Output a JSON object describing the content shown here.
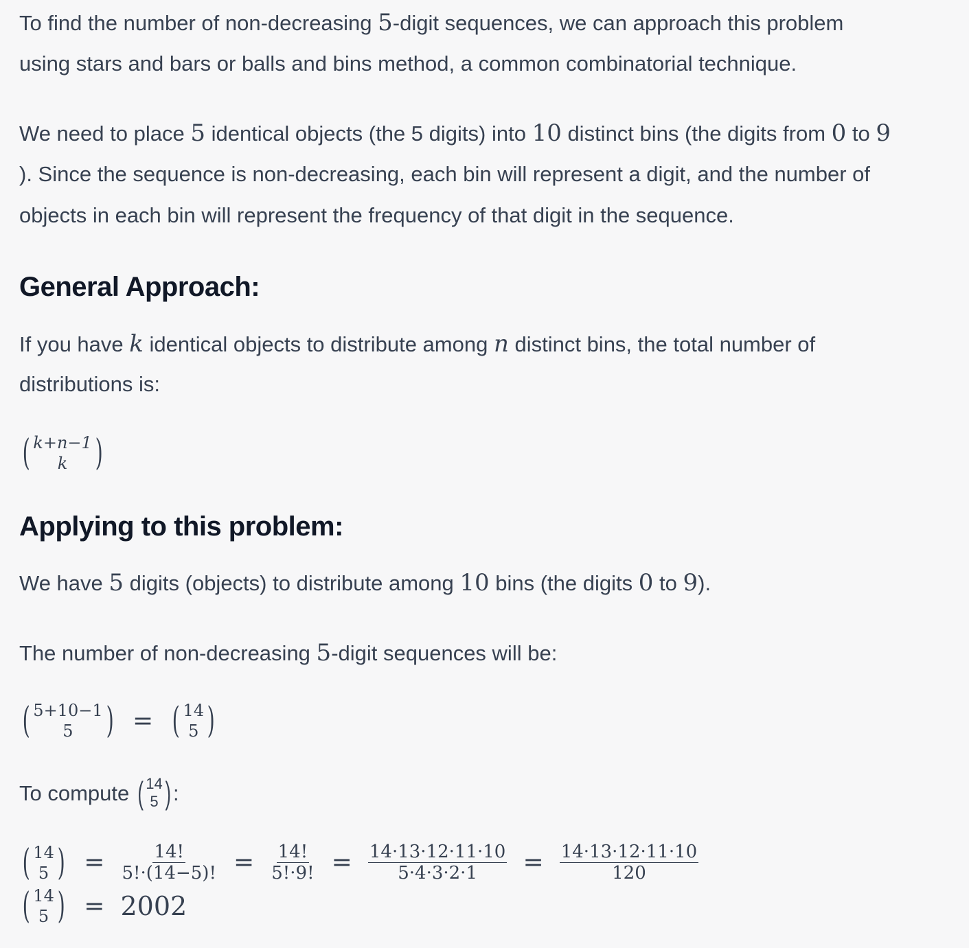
{
  "intro": {
    "line1_a": "To find the number of non-decreasing ",
    "line1_num": "5",
    "line1_b": "-digit sequences, we can approach this problem",
    "line2": "using stars and bars or balls and bins method, a common combinatorial technique."
  },
  "para2": {
    "a": "We need to place ",
    "n5": "5",
    "b": " identical objects (the 5 digits) into ",
    "n10": "10",
    "c": " distinct bins (the digits from ",
    "n0": "0",
    "d": " to ",
    "n9": "9",
    "line2": "). Since the sequence is non-decreasing, each bin will represent a digit, and the number of",
    "line3": "objects in each bin will represent the frequency of that digit in the sequence."
  },
  "heading1": "General Approach:",
  "general": {
    "a": "If you have ",
    "k": "k",
    "b": " identical objects to distribute among ",
    "n": "n",
    "c": " distinct bins, the total number of",
    "line2": "distributions is:"
  },
  "formula1": {
    "top": "k+n−1",
    "bottom": "k"
  },
  "heading2": "Applying to this problem:",
  "apply": {
    "a": "We have ",
    "n5": "5",
    "b": " digits (objects) to distribute among ",
    "n10": "10",
    "c": " bins (the digits ",
    "n0": "0",
    "d": " to ",
    "n9": "9",
    "e": ")."
  },
  "number_line": {
    "a": "The number of non-decreasing ",
    "n5": "5",
    "b": "-digit sequences will be:"
  },
  "formula2": {
    "left_top": "5+10−1",
    "left_bottom": "5",
    "eq": "=",
    "right_top": "14",
    "right_bottom": "5"
  },
  "compute": {
    "a": "To compute ",
    "top": "14",
    "bottom": "5",
    "b": ":"
  },
  "formula3": {
    "binom_top": "14",
    "binom_bottom": "5",
    "eq": "=",
    "f1_num": "14!",
    "f1_den": "5!·(14−5)!",
    "f2_num": "14!",
    "f2_den": "5!·9!",
    "f3_num": "14·13·12·11·10",
    "f3_den": "5·4·3·2·1",
    "f4_num": "14·13·12·11·10",
    "f4_den": "120"
  },
  "formula4": {
    "binom_top": "14",
    "binom_bottom": "5",
    "eq": "=",
    "result": "2002"
  }
}
